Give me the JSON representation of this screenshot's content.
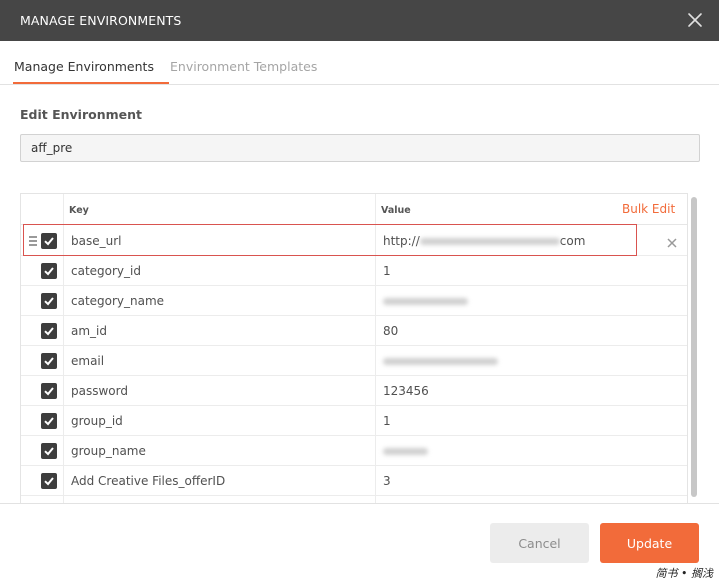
{
  "dialog": {
    "title": "MANAGE ENVIRONMENTS",
    "close_icon": "close-icon"
  },
  "tabs": [
    {
      "label": "Manage Environments",
      "active": true
    },
    {
      "label": "Environment Templates",
      "active": false
    }
  ],
  "edit": {
    "label": "Edit Environment",
    "name_value": "aff_pre"
  },
  "table": {
    "headers": {
      "key": "Key",
      "value": "Value"
    },
    "bulk_edit": "Bulk Edit",
    "rows": [
      {
        "key": "base_url",
        "value_prefix": "http://",
        "value_suffix": "com",
        "enabled": true,
        "highlighted": true
      },
      {
        "key": "category_id",
        "value": "1",
        "enabled": true
      },
      {
        "key": "category_name",
        "value": "",
        "enabled": true
      },
      {
        "key": "am_id",
        "value": "80",
        "enabled": true
      },
      {
        "key": "email",
        "value": "",
        "enabled": true
      },
      {
        "key": "password",
        "value": "123456",
        "enabled": true
      },
      {
        "key": "group_id",
        "value": "1",
        "enabled": true
      },
      {
        "key": "group_name",
        "value": "",
        "enabled": true
      },
      {
        "key": "Add Creative Files_offerID",
        "value": "3",
        "enabled": true
      }
    ]
  },
  "footer": {
    "cancel_label": "Cancel",
    "update_label": "Update"
  },
  "watermark": "简书 • 搁浅",
  "colors": {
    "titlebar": "#464646",
    "accent": "#f26b3a",
    "highlight_border": "#d9534f"
  }
}
